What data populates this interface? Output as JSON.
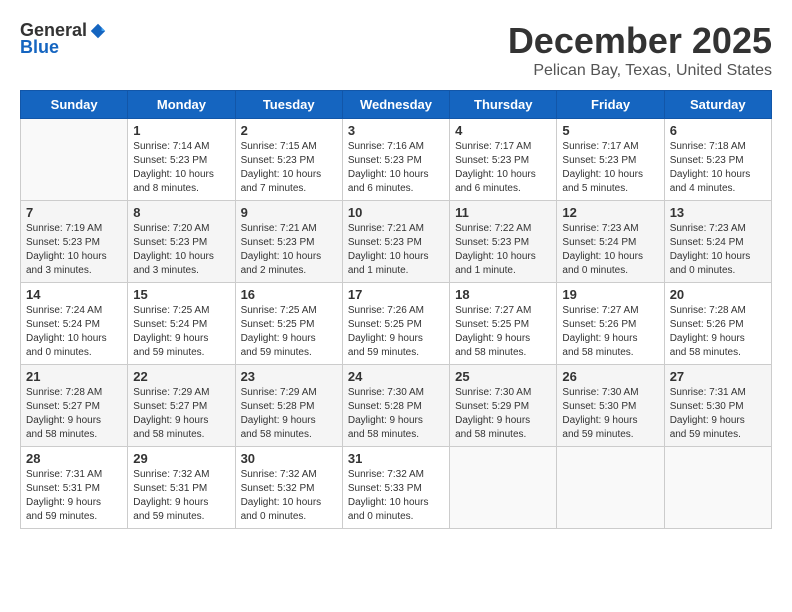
{
  "logo": {
    "general": "General",
    "blue": "Blue"
  },
  "title": "December 2025",
  "subtitle": "Pelican Bay, Texas, United States",
  "headers": [
    "Sunday",
    "Monday",
    "Tuesday",
    "Wednesday",
    "Thursday",
    "Friday",
    "Saturday"
  ],
  "weeks": [
    [
      {
        "day": "",
        "info": ""
      },
      {
        "day": "1",
        "info": "Sunrise: 7:14 AM\nSunset: 5:23 PM\nDaylight: 10 hours\nand 8 minutes."
      },
      {
        "day": "2",
        "info": "Sunrise: 7:15 AM\nSunset: 5:23 PM\nDaylight: 10 hours\nand 7 minutes."
      },
      {
        "day": "3",
        "info": "Sunrise: 7:16 AM\nSunset: 5:23 PM\nDaylight: 10 hours\nand 6 minutes."
      },
      {
        "day": "4",
        "info": "Sunrise: 7:17 AM\nSunset: 5:23 PM\nDaylight: 10 hours\nand 6 minutes."
      },
      {
        "day": "5",
        "info": "Sunrise: 7:17 AM\nSunset: 5:23 PM\nDaylight: 10 hours\nand 5 minutes."
      },
      {
        "day": "6",
        "info": "Sunrise: 7:18 AM\nSunset: 5:23 PM\nDaylight: 10 hours\nand 4 minutes."
      }
    ],
    [
      {
        "day": "7",
        "info": "Sunrise: 7:19 AM\nSunset: 5:23 PM\nDaylight: 10 hours\nand 3 minutes."
      },
      {
        "day": "8",
        "info": "Sunrise: 7:20 AM\nSunset: 5:23 PM\nDaylight: 10 hours\nand 3 minutes."
      },
      {
        "day": "9",
        "info": "Sunrise: 7:21 AM\nSunset: 5:23 PM\nDaylight: 10 hours\nand 2 minutes."
      },
      {
        "day": "10",
        "info": "Sunrise: 7:21 AM\nSunset: 5:23 PM\nDaylight: 10 hours\nand 1 minute."
      },
      {
        "day": "11",
        "info": "Sunrise: 7:22 AM\nSunset: 5:23 PM\nDaylight: 10 hours\nand 1 minute."
      },
      {
        "day": "12",
        "info": "Sunrise: 7:23 AM\nSunset: 5:24 PM\nDaylight: 10 hours\nand 0 minutes."
      },
      {
        "day": "13",
        "info": "Sunrise: 7:23 AM\nSunset: 5:24 PM\nDaylight: 10 hours\nand 0 minutes."
      }
    ],
    [
      {
        "day": "14",
        "info": "Sunrise: 7:24 AM\nSunset: 5:24 PM\nDaylight: 10 hours\nand 0 minutes."
      },
      {
        "day": "15",
        "info": "Sunrise: 7:25 AM\nSunset: 5:24 PM\nDaylight: 9 hours\nand 59 minutes."
      },
      {
        "day": "16",
        "info": "Sunrise: 7:25 AM\nSunset: 5:25 PM\nDaylight: 9 hours\nand 59 minutes."
      },
      {
        "day": "17",
        "info": "Sunrise: 7:26 AM\nSunset: 5:25 PM\nDaylight: 9 hours\nand 59 minutes."
      },
      {
        "day": "18",
        "info": "Sunrise: 7:27 AM\nSunset: 5:25 PM\nDaylight: 9 hours\nand 58 minutes."
      },
      {
        "day": "19",
        "info": "Sunrise: 7:27 AM\nSunset: 5:26 PM\nDaylight: 9 hours\nand 58 minutes."
      },
      {
        "day": "20",
        "info": "Sunrise: 7:28 AM\nSunset: 5:26 PM\nDaylight: 9 hours\nand 58 minutes."
      }
    ],
    [
      {
        "day": "21",
        "info": "Sunrise: 7:28 AM\nSunset: 5:27 PM\nDaylight: 9 hours\nand 58 minutes."
      },
      {
        "day": "22",
        "info": "Sunrise: 7:29 AM\nSunset: 5:27 PM\nDaylight: 9 hours\nand 58 minutes."
      },
      {
        "day": "23",
        "info": "Sunrise: 7:29 AM\nSunset: 5:28 PM\nDaylight: 9 hours\nand 58 minutes."
      },
      {
        "day": "24",
        "info": "Sunrise: 7:30 AM\nSunset: 5:28 PM\nDaylight: 9 hours\nand 58 minutes."
      },
      {
        "day": "25",
        "info": "Sunrise: 7:30 AM\nSunset: 5:29 PM\nDaylight: 9 hours\nand 58 minutes."
      },
      {
        "day": "26",
        "info": "Sunrise: 7:30 AM\nSunset: 5:30 PM\nDaylight: 9 hours\nand 59 minutes."
      },
      {
        "day": "27",
        "info": "Sunrise: 7:31 AM\nSunset: 5:30 PM\nDaylight: 9 hours\nand 59 minutes."
      }
    ],
    [
      {
        "day": "28",
        "info": "Sunrise: 7:31 AM\nSunset: 5:31 PM\nDaylight: 9 hours\nand 59 minutes."
      },
      {
        "day": "29",
        "info": "Sunrise: 7:32 AM\nSunset: 5:31 PM\nDaylight: 9 hours\nand 59 minutes."
      },
      {
        "day": "30",
        "info": "Sunrise: 7:32 AM\nSunset: 5:32 PM\nDaylight: 10 hours\nand 0 minutes."
      },
      {
        "day": "31",
        "info": "Sunrise: 7:32 AM\nSunset: 5:33 PM\nDaylight: 10 hours\nand 0 minutes."
      },
      {
        "day": "",
        "info": ""
      },
      {
        "day": "",
        "info": ""
      },
      {
        "day": "",
        "info": ""
      }
    ]
  ]
}
